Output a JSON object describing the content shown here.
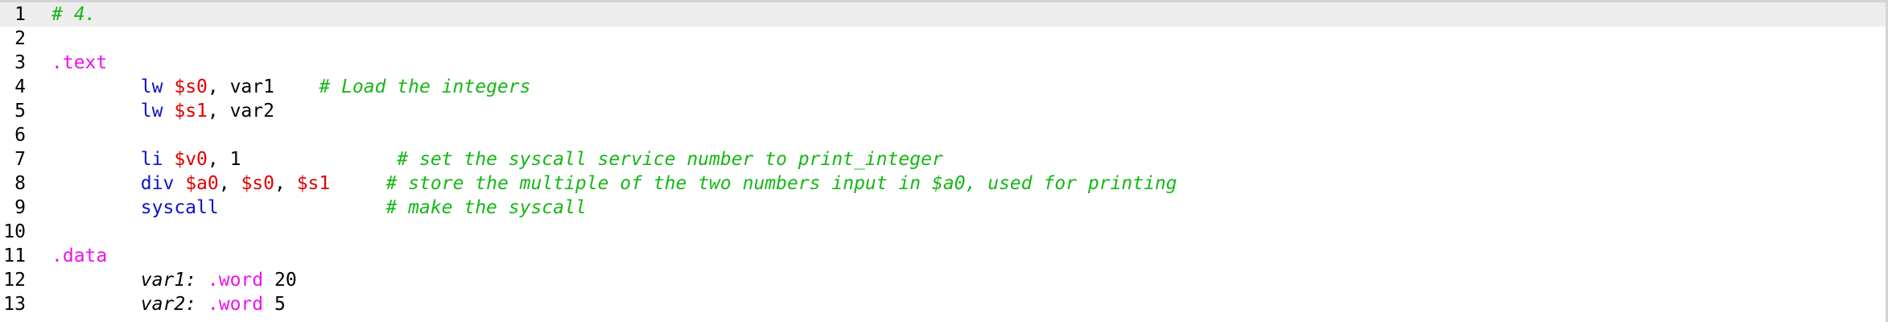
{
  "editor": {
    "colors": {
      "comment": "#15b815",
      "directive": "#ee11ee",
      "instruction": "#0a14c8",
      "register": "#e00000",
      "text": "#000000",
      "current_line_bg": "#ededed"
    },
    "lines": [
      {
        "number": "1",
        "tokens": [
          "# 4."
        ]
      },
      {
        "number": "2",
        "tokens": []
      },
      {
        "number": "3",
        "tokens": [
          ".text"
        ]
      },
      {
        "number": "4",
        "tokens": [
          "        ",
          "lw",
          " ",
          "$s0",
          ", var1    ",
          "# Load the integers"
        ]
      },
      {
        "number": "5",
        "tokens": [
          "        ",
          "lw",
          " ",
          "$s1",
          ", var2"
        ]
      },
      {
        "number": "6",
        "tokens": []
      },
      {
        "number": "7",
        "tokens": [
          "        ",
          "li",
          " ",
          "$v0",
          ", 1              ",
          "# set the syscall service number to print_integer"
        ]
      },
      {
        "number": "8",
        "tokens": [
          "        ",
          "div",
          " ",
          "$a0",
          ", ",
          "$s0",
          ", ",
          "$s1",
          "     ",
          "# store the multiple of the two numbers input in $a0, used for printing"
        ]
      },
      {
        "number": "9",
        "tokens": [
          "        ",
          "syscall",
          "               ",
          "# make the syscall"
        ]
      },
      {
        "number": "10",
        "tokens": []
      },
      {
        "number": "11",
        "tokens": [
          ".data"
        ]
      },
      {
        "number": "12",
        "tokens": [
          "        ",
          "var1:",
          " ",
          ".word",
          " ",
          "20"
        ]
      },
      {
        "number": "13",
        "tokens": [
          "        ",
          "var2:",
          " ",
          ".word",
          " ",
          "5"
        ]
      }
    ]
  }
}
